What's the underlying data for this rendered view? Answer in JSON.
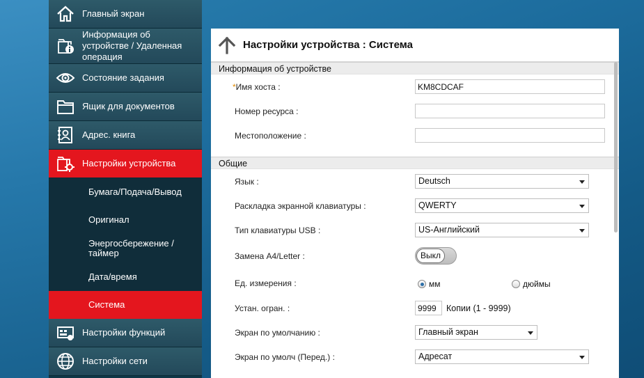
{
  "nav": {
    "items": [
      {
        "label": "Главный экран",
        "icon": "home-icon"
      },
      {
        "label": "Информация об устройстве / Удаленная операция",
        "icon": "device-info-icon"
      },
      {
        "label": "Состояние задания",
        "icon": "eye-icon"
      },
      {
        "label": "Ящик для документов",
        "icon": "folder-icon"
      },
      {
        "label": "Адрес. книга",
        "icon": "address-book-icon"
      },
      {
        "label": "Настройки устройства",
        "icon": "device-settings-icon"
      }
    ],
    "sub_items": [
      {
        "label": "Бумага/Подача/Вывод"
      },
      {
        "label": "Оригинал"
      },
      {
        "label": "Энергосбережение / таймер"
      },
      {
        "label": "Дата/время"
      },
      {
        "label": "Система"
      }
    ],
    "items_after": [
      {
        "label": "Настройки функций",
        "icon": "function-settings-icon"
      },
      {
        "label": "Настройки сети",
        "icon": "network-globe-icon"
      }
    ],
    "active_color": "#e4161e"
  },
  "page": {
    "title": "Настройки устройства : Система"
  },
  "device_info": {
    "section_title": "Информация об устройстве",
    "host_name_req": "*",
    "host_name_label": "Имя хоста :",
    "host_name_value": "KM8CDCAF",
    "asset_number_label": "Номер ресурса :",
    "asset_number_value": "",
    "location_label": "Местоположение :",
    "location_value": ""
  },
  "general": {
    "section_title": "Общие",
    "language_label": "Язык :",
    "language_value": "Deutsch",
    "keyboard_layout_label": "Раскладка экранной клавиатуры :",
    "keyboard_layout_value": "QWERTY",
    "usb_keyboard_label": "Тип клавиатуры USB :",
    "usb_keyboard_value": "US-Английский",
    "a4_letter_label": "Замена A4/Letter :",
    "a4_letter_toggle": "Выкл",
    "units_label": "Ед. измерения :",
    "units_mm": "мм",
    "units_inch": "дюймы",
    "units_selected": "мм",
    "limit_label": "Устан. огран. :",
    "limit_value": "9999",
    "limit_range": "Копии (1 - 9999)",
    "default_screen_label": "Экран по умолчанию :",
    "default_screen_value": "Главный экран",
    "default_screen_send_label": "Экран по умолч (Перед.) :",
    "default_screen_send_value": "Адресат"
  }
}
